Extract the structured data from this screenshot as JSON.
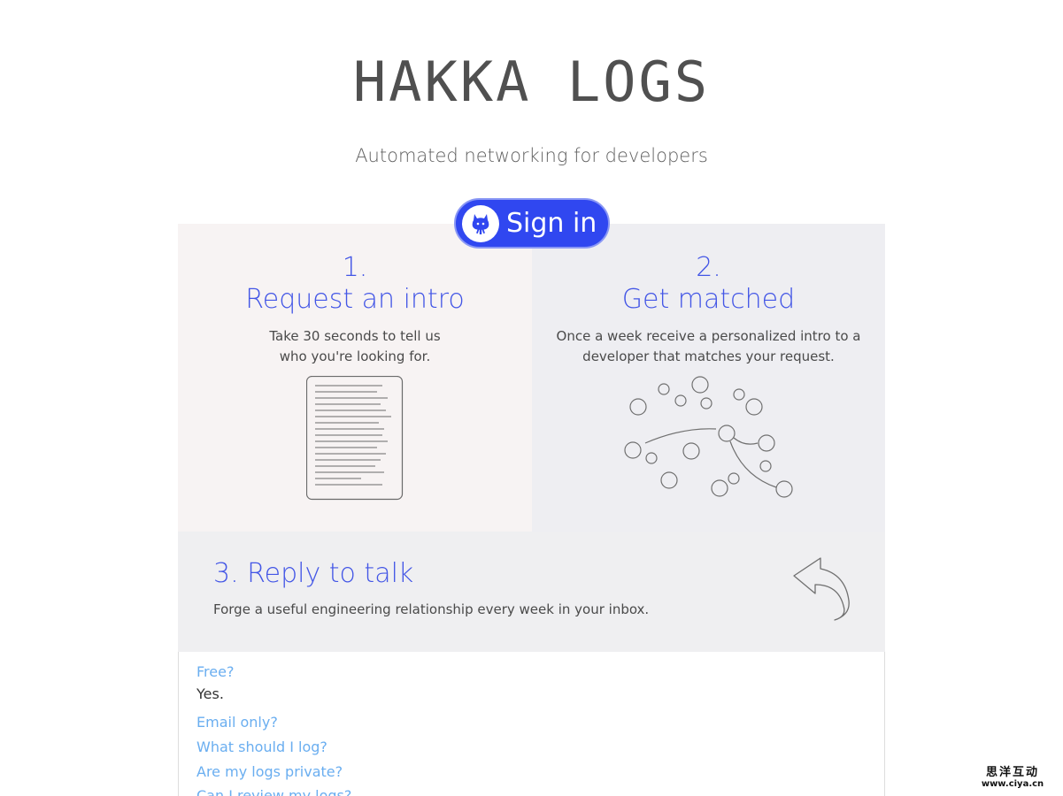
{
  "header": {
    "logo": "HAKKA LOGS",
    "tagline": "Automated networking for developers"
  },
  "signin": {
    "label": "Sign in",
    "icon": "github-icon"
  },
  "steps": [
    {
      "number": "1.",
      "title": "Request an intro",
      "desc_line1": "Take 30 seconds to tell us",
      "desc_line2": "who you're looking for.",
      "icon": "document-icon"
    },
    {
      "number": "2.",
      "title": "Get matched",
      "desc_line1": "Once a week receive a personalized intro to a",
      "desc_line2": "developer that matches your request.",
      "icon": "network-icon"
    },
    {
      "title": "3. Reply to talk",
      "desc": "Forge a useful engineering relationship every week in your inbox.",
      "icon": "reply-arrow-icon"
    }
  ],
  "faq": [
    {
      "question": "Free?",
      "answer": "Yes."
    },
    {
      "question": "Email only?"
    },
    {
      "question": "What should I log?"
    },
    {
      "question": "Are my logs private?"
    },
    {
      "question": "Can I review my logs?"
    }
  ],
  "watermark": {
    "name": "思洋互动",
    "url": "www.ciya.cn"
  },
  "colors": {
    "accent": "#4356e6",
    "button": "#3047f0",
    "link": "#6aaef0"
  }
}
